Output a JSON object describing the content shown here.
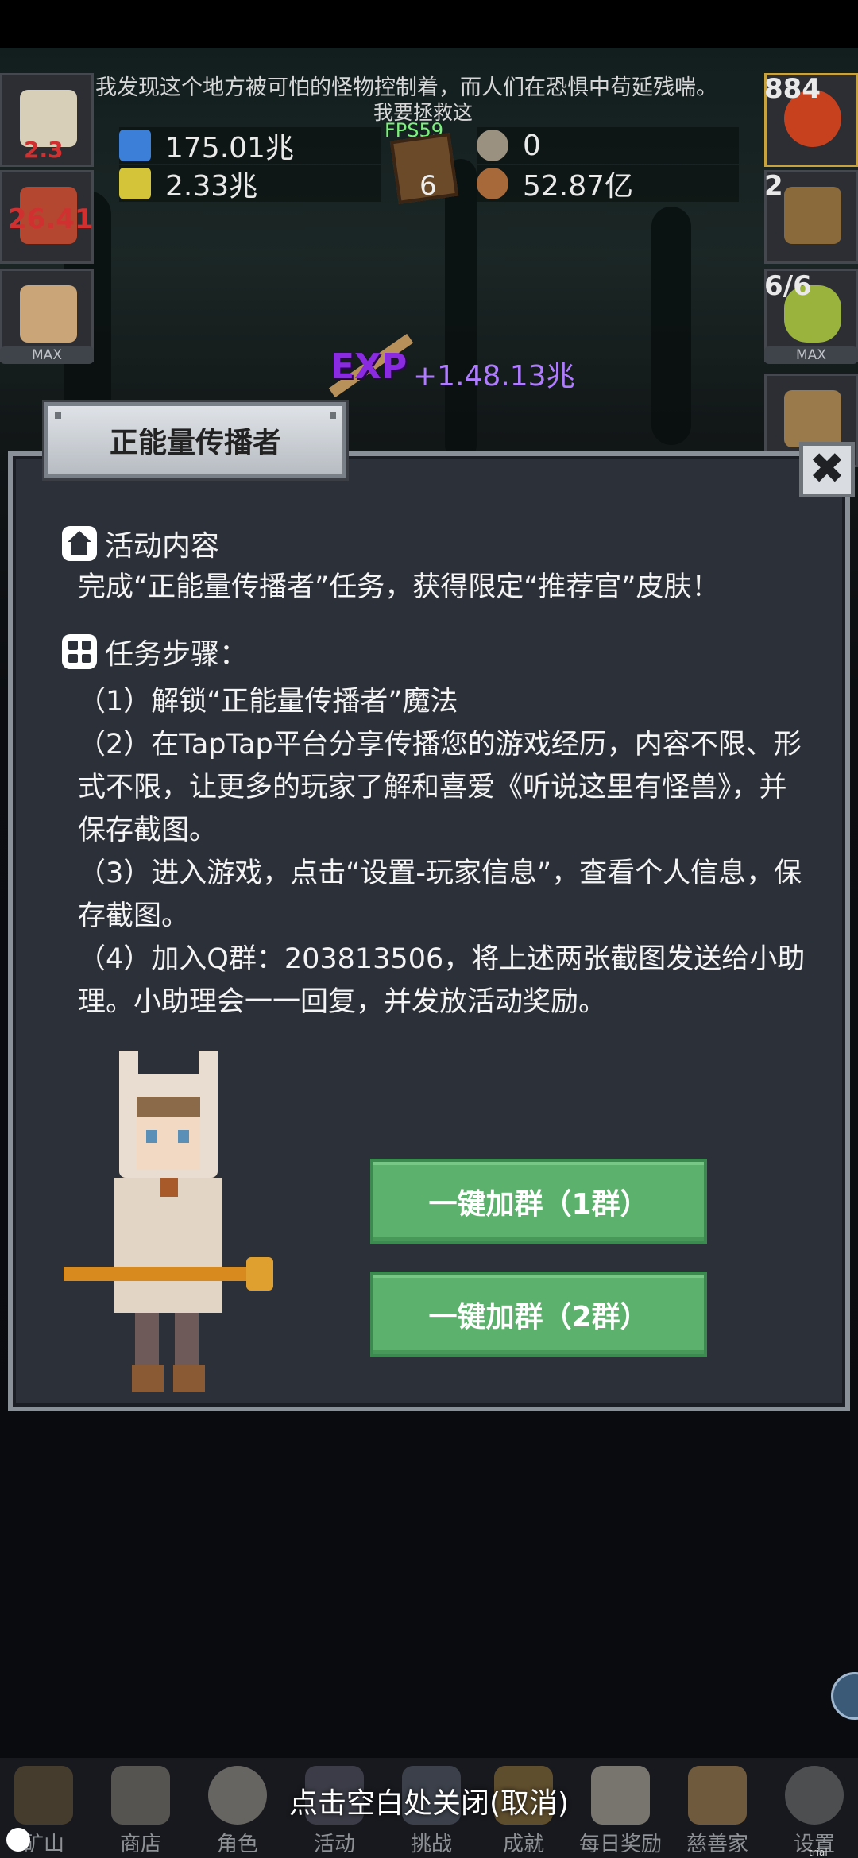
{
  "hud": {
    "marquee_line1": "我发现这个地方被可怕的怪物控制着，而人们在恐惧中苟延残喘。",
    "marquee_line2": "我要拯救这",
    "fps": "FPS59",
    "resources": [
      {
        "value": "175.01兆",
        "icon": "blue-potion-icon"
      },
      {
        "value": "2.33兆",
        "icon": "yellow-potion-icon"
      },
      {
        "value": "0",
        "icon": "stone-icon"
      },
      {
        "value": "52.87亿",
        "icon": "meat-icon"
      }
    ],
    "book_count": "6",
    "left_slots": [
      "2.3",
      "26.41"
    ],
    "right_slots": [
      "884",
      "2",
      "6/6"
    ],
    "max_label": "MAX",
    "exp_label": "EXP",
    "exp_value": "+1.48.13兆"
  },
  "dialog": {
    "title": "正能量传播者",
    "close_symbol": "✖",
    "section1_title": "活动内容",
    "intro": "完成“正能量传播者”任务，获得限定“推荐官”皮肤！",
    "section2_title": "任务步骤：",
    "steps": [
      "（1）解锁“正能量传播者”魔法",
      "（2）在TapTap平台分享传播您的游戏经历，内容不限、形式不限，让更多的玩家了解和喜爱《听说这里有怪兽》，并保存截图。",
      "（3）进入游戏，点击“设置-玩家信息”，查看个人信息，保存截图。",
      "（4）加入Q群：203813506，将上述两张截图发送给小助理。小助理会一一回复，并发放活动奖励。"
    ],
    "join_group_1": "一键加群（1群）",
    "join_group_2": "一键加群（2群）"
  },
  "bottom": {
    "close_hint": "点击空白处关闭(取消)",
    "nav": [
      "矿山",
      "商店",
      "角色",
      "活动",
      "挑战",
      "成就",
      "每日奖励",
      "慈善家",
      "设置"
    ]
  },
  "watermark": "trial version",
  "colors": {
    "dialog_bg": "#2c3039",
    "button_green": "#5cb26d",
    "exp_purple": "#8a2be2"
  }
}
